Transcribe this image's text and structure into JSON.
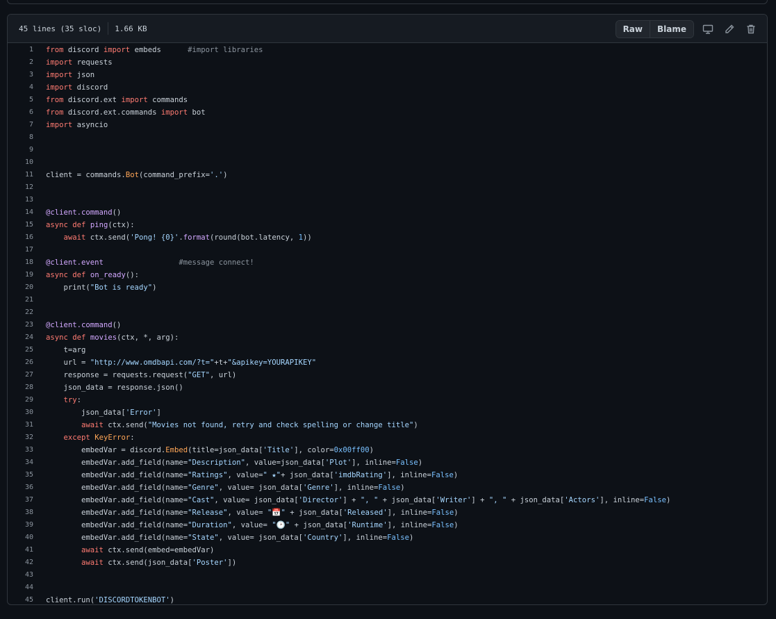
{
  "file": {
    "lines_info": "45 lines (35 sloc)",
    "size": "1.66 KB"
  },
  "toolbar": {
    "raw_label": "Raw",
    "blame_label": "Blame",
    "icons": [
      "desktop-icon",
      "pencil-icon",
      "trash-icon"
    ]
  },
  "colors": {
    "keyword": "#ff7b72",
    "string": "#a5d6ff",
    "comment": "#8b949e",
    "function": "#d2a8ff",
    "constant": "#79c0ff",
    "builtin": "#ffa657"
  },
  "code_lines": [
    [
      [
        "k",
        "from"
      ],
      [
        "p",
        " discord "
      ],
      [
        "k",
        "import"
      ],
      [
        "p",
        " embeds      "
      ],
      [
        "c",
        "#import libraries"
      ]
    ],
    [
      [
        "k",
        "import"
      ],
      [
        "p",
        " requests"
      ]
    ],
    [
      [
        "k",
        "import"
      ],
      [
        "p",
        " json"
      ]
    ],
    [
      [
        "k",
        "import"
      ],
      [
        "p",
        " discord"
      ]
    ],
    [
      [
        "k",
        "from"
      ],
      [
        "p",
        " discord.ext "
      ],
      [
        "k",
        "import"
      ],
      [
        "p",
        " commands"
      ]
    ],
    [
      [
        "k",
        "from"
      ],
      [
        "p",
        " discord.ext.commands "
      ],
      [
        "k",
        "import"
      ],
      [
        "p",
        " bot"
      ]
    ],
    [
      [
        "k",
        "import"
      ],
      [
        "p",
        " asyncio"
      ]
    ],
    [],
    [],
    [],
    [
      [
        "p",
        "client = commands."
      ],
      [
        "b",
        "Bot"
      ],
      [
        "p",
        "(command_prefix="
      ],
      [
        "s",
        "'.'"
      ],
      [
        "p",
        ")"
      ]
    ],
    [],
    [],
    [
      [
        "f",
        "@client.command"
      ],
      [
        "p",
        "()"
      ]
    ],
    [
      [
        "k",
        "async"
      ],
      [
        "p",
        " "
      ],
      [
        "k",
        "def"
      ],
      [
        "p",
        " "
      ],
      [
        "f",
        "ping"
      ],
      [
        "p",
        "(ctx):"
      ]
    ],
    [
      [
        "p",
        "    "
      ],
      [
        "k",
        "await"
      ],
      [
        "p",
        " ctx.send("
      ],
      [
        "s",
        "'Pong! {0}'"
      ],
      [
        "p",
        "."
      ],
      [
        "f",
        "format"
      ],
      [
        "p",
        "(round(bot.latency, "
      ],
      [
        "n",
        "1"
      ],
      [
        "p",
        "))"
      ]
    ],
    [],
    [
      [
        "f",
        "@client.event"
      ],
      [
        "p",
        "                 "
      ],
      [
        "c",
        "#message connect!"
      ]
    ],
    [
      [
        "k",
        "async"
      ],
      [
        "p",
        " "
      ],
      [
        "k",
        "def"
      ],
      [
        "p",
        " "
      ],
      [
        "f",
        "on_ready"
      ],
      [
        "p",
        "():"
      ]
    ],
    [
      [
        "p",
        "    print("
      ],
      [
        "s",
        "\"Bot is ready\""
      ],
      [
        "p",
        ")"
      ]
    ],
    [],
    [],
    [
      [
        "f",
        "@client.command"
      ],
      [
        "p",
        "()"
      ]
    ],
    [
      [
        "k",
        "async"
      ],
      [
        "p",
        " "
      ],
      [
        "k",
        "def"
      ],
      [
        "p",
        " "
      ],
      [
        "f",
        "movies"
      ],
      [
        "p",
        "(ctx, *, arg):"
      ]
    ],
    [
      [
        "p",
        "    t=arg"
      ]
    ],
    [
      [
        "p",
        "    url = "
      ],
      [
        "s",
        "\"http://www.omdbapi.com/?t=\""
      ],
      [
        "p",
        "+t+"
      ],
      [
        "s",
        "\"&apikey=YOURAPIKEY\""
      ]
    ],
    [
      [
        "p",
        "    response = requests.request("
      ],
      [
        "s",
        "\"GET\""
      ],
      [
        "p",
        ", url)"
      ]
    ],
    [
      [
        "p",
        "    json_data = response.json()"
      ]
    ],
    [
      [
        "p",
        "    "
      ],
      [
        "k",
        "try"
      ],
      [
        "p",
        ":"
      ]
    ],
    [
      [
        "p",
        "        json_data["
      ],
      [
        "s",
        "'Error'"
      ],
      [
        "p",
        "]"
      ]
    ],
    [
      [
        "p",
        "        "
      ],
      [
        "k",
        "await"
      ],
      [
        "p",
        " ctx.send("
      ],
      [
        "s",
        "\"Movies not found, retry and check spelling or change title\""
      ],
      [
        "p",
        ")"
      ]
    ],
    [
      [
        "p",
        "    "
      ],
      [
        "k",
        "except"
      ],
      [
        "p",
        " "
      ],
      [
        "b",
        "KeyError"
      ],
      [
        "p",
        ":"
      ]
    ],
    [
      [
        "p",
        "        embedVar = discord."
      ],
      [
        "b",
        "Embed"
      ],
      [
        "p",
        "(title=json_data["
      ],
      [
        "s",
        "'Title'"
      ],
      [
        "p",
        "], color="
      ],
      [
        "n",
        "0x00ff00"
      ],
      [
        "p",
        ")"
      ]
    ],
    [
      [
        "p",
        "        embedVar.add_field(name="
      ],
      [
        "s",
        "\"Description\""
      ],
      [
        "p",
        ", value=json_data["
      ],
      [
        "s",
        "'Plot'"
      ],
      [
        "p",
        "], inline="
      ],
      [
        "n",
        "False"
      ],
      [
        "p",
        ")"
      ]
    ],
    [
      [
        "p",
        "        embedVar.add_field(name="
      ],
      [
        "s",
        "\"Ratings\""
      ],
      [
        "p",
        ", value="
      ],
      [
        "s",
        "\" ★\""
      ],
      [
        "p",
        "+ json_data["
      ],
      [
        "s",
        "'imdbRating'"
      ],
      [
        "p",
        "], inline="
      ],
      [
        "n",
        "False"
      ],
      [
        "p",
        ")"
      ]
    ],
    [
      [
        "p",
        "        embedVar.add_field(name="
      ],
      [
        "s",
        "\"Genre\""
      ],
      [
        "p",
        ", value= json_data["
      ],
      [
        "s",
        "'Genre'"
      ],
      [
        "p",
        "], inline="
      ],
      [
        "n",
        "False"
      ],
      [
        "p",
        ")"
      ]
    ],
    [
      [
        "p",
        "        embedVar.add_field(name="
      ],
      [
        "s",
        "\"Cast\""
      ],
      [
        "p",
        ", value= json_data["
      ],
      [
        "s",
        "'Director'"
      ],
      [
        "p",
        "] + "
      ],
      [
        "s",
        "\", \""
      ],
      [
        "p",
        " + json_data["
      ],
      [
        "s",
        "'Writer'"
      ],
      [
        "p",
        "] + "
      ],
      [
        "s",
        "\", \""
      ],
      [
        "p",
        " + json_data["
      ],
      [
        "s",
        "'Actors'"
      ],
      [
        "p",
        "], inline="
      ],
      [
        "n",
        "False"
      ],
      [
        "p",
        ")"
      ]
    ],
    [
      [
        "p",
        "        embedVar.add_field(name="
      ],
      [
        "s",
        "\"Release\""
      ],
      [
        "p",
        ", value= "
      ],
      [
        "s",
        "\"📅\""
      ],
      [
        "p",
        " + json_data["
      ],
      [
        "s",
        "'Released'"
      ],
      [
        "p",
        "], inline="
      ],
      [
        "n",
        "False"
      ],
      [
        "p",
        ")"
      ]
    ],
    [
      [
        "p",
        "        embedVar.add_field(name="
      ],
      [
        "s",
        "\"Duration\""
      ],
      [
        "p",
        ", value= "
      ],
      [
        "s",
        "\"🕑\""
      ],
      [
        "p",
        " + json_data["
      ],
      [
        "s",
        "'Runtime'"
      ],
      [
        "p",
        "], inline="
      ],
      [
        "n",
        "False"
      ],
      [
        "p",
        ")"
      ]
    ],
    [
      [
        "p",
        "        embedVar.add_field(name="
      ],
      [
        "s",
        "\"State\""
      ],
      [
        "p",
        ", value= json_data["
      ],
      [
        "s",
        "'Country'"
      ],
      [
        "p",
        "], inline="
      ],
      [
        "n",
        "False"
      ],
      [
        "p",
        ")"
      ]
    ],
    [
      [
        "p",
        "        "
      ],
      [
        "k",
        "await"
      ],
      [
        "p",
        " ctx.send(embed=embedVar)"
      ]
    ],
    [
      [
        "p",
        "        "
      ],
      [
        "k",
        "await"
      ],
      [
        "p",
        " ctx.send(json_data["
      ],
      [
        "s",
        "'Poster'"
      ],
      [
        "p",
        "])"
      ]
    ],
    [],
    [],
    [
      [
        "p",
        "client.run("
      ],
      [
        "s",
        "'DISCORDTOKENBOT'"
      ],
      [
        "p",
        ")"
      ]
    ]
  ]
}
